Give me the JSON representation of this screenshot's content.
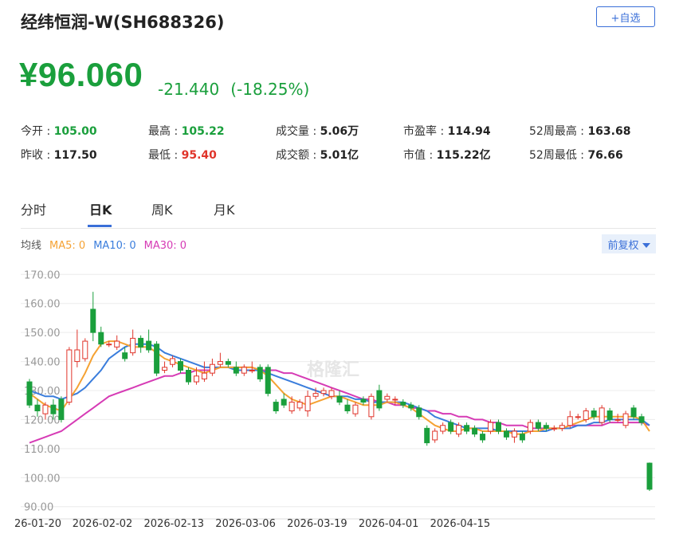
{
  "header": {
    "title": "经纬恒润-W(SH688326)",
    "watch_label": "+自选"
  },
  "quote": {
    "price": "¥96.060",
    "change": "-21.440",
    "change_pct": "(-18.25%)"
  },
  "stats": {
    "open_label": "今开 : ",
    "open": "105.00",
    "prev_close_label": "昨收 : ",
    "prev_close": "117.50",
    "high_label": "最高 : ",
    "high": "105.22",
    "low_label": "最低 : ",
    "low": "95.40",
    "volume_label": "成交量 : ",
    "volume": "5.06万",
    "turnover_label": "成交额 : ",
    "turnover": "5.01亿",
    "pe_label": "市盈率 : ",
    "pe": "114.94",
    "mktcap_label": "市值 : ",
    "mktcap": "115.22亿",
    "wk52_high_label": "52周最高 : ",
    "wk52_high": "163.68",
    "wk52_low_label": "52周最低 : ",
    "wk52_low": "76.66"
  },
  "tabs": [
    "分时",
    "日K",
    "周K",
    "月K"
  ],
  "active_tab": 1,
  "ma": {
    "label": "均线",
    "ma5": "MA5: 0",
    "ma10": "MA10: 0",
    "ma30": "MA30: 0"
  },
  "adjust_label": "前复权",
  "colors": {
    "up": "#e0352b",
    "down": "#1a9f3c",
    "ma5": "#f5a233",
    "ma10": "#3a7ddc",
    "ma30": "#d63bb5",
    "accent": "#3a6fd8"
  },
  "chart_data": {
    "type": "candlestick",
    "ylim": [
      88,
      172
    ],
    "y_ticks": [
      "170.00",
      "160.00",
      "150.00",
      "140.00",
      "130.00",
      "120.00",
      "110.00",
      "100.00",
      "90.00"
    ],
    "x_labels": [
      "26-01-20",
      "2026-02-02",
      "2026-02-13",
      "2026-03-06",
      "2026-03-19",
      "2026-04-01",
      "2026-04-15"
    ],
    "x_label_index": [
      0,
      9,
      18,
      27,
      36,
      45,
      54
    ],
    "candles": [
      [
        133,
        125,
        134,
        124
      ],
      [
        125,
        123,
        127,
        121
      ],
      [
        122,
        125,
        126,
        120
      ],
      [
        125,
        122,
        127,
        120
      ],
      [
        127,
        120,
        128,
        119
      ],
      [
        126,
        144,
        145,
        125
      ],
      [
        140,
        144,
        151,
        138
      ],
      [
        141,
        147,
        148,
        140
      ],
      [
        158,
        150,
        164,
        147
      ],
      [
        150,
        146,
        152,
        145
      ],
      [
        146,
        146,
        147,
        145
      ],
      [
        145,
        147,
        149,
        144
      ],
      [
        143,
        141,
        145,
        140
      ],
      [
        143,
        148,
        151,
        142
      ],
      [
        148,
        145,
        149,
        143
      ],
      [
        147,
        144,
        151,
        143
      ],
      [
        146,
        136,
        147,
        135
      ],
      [
        137,
        138,
        140,
        136
      ],
      [
        139,
        141,
        142,
        138
      ],
      [
        140,
        137,
        141,
        136
      ],
      [
        137,
        133,
        138,
        132
      ],
      [
        133,
        135,
        138,
        132
      ],
      [
        134,
        136,
        140,
        133
      ],
      [
        136,
        139,
        141,
        135
      ],
      [
        139,
        140,
        143,
        138
      ],
      [
        140,
        139,
        141,
        138
      ],
      [
        138,
        136,
        140,
        135
      ],
      [
        136,
        138,
        139,
        135
      ],
      [
        137,
        137,
        140,
        136
      ],
      [
        138,
        134,
        139,
        133
      ],
      [
        138,
        129,
        139,
        128
      ],
      [
        126,
        123,
        127,
        122
      ],
      [
        127,
        125,
        129,
        124
      ],
      [
        123,
        126,
        128,
        122
      ],
      [
        124,
        126,
        127,
        123
      ],
      [
        123,
        128,
        130,
        121
      ],
      [
        128,
        129,
        131,
        127
      ],
      [
        129,
        130,
        131,
        128
      ],
      [
        128,
        130,
        131,
        127
      ],
      [
        128,
        126,
        130,
        125
      ],
      [
        125,
        123,
        127,
        122
      ],
      [
        122,
        125,
        126,
        121
      ],
      [
        127,
        126,
        128,
        125
      ],
      [
        121,
        128,
        129,
        120
      ],
      [
        130,
        124,
        132,
        123
      ],
      [
        127,
        128,
        129,
        126
      ],
      [
        127,
        127,
        128,
        125
      ],
      [
        126,
        125,
        127,
        124
      ],
      [
        125,
        124,
        126,
        123
      ],
      [
        124,
        121,
        125,
        120
      ],
      [
        117,
        112,
        118,
        111
      ],
      [
        113,
        116,
        117,
        112
      ],
      [
        116,
        118,
        119,
        115
      ],
      [
        119,
        116,
        120,
        115
      ],
      [
        115,
        118,
        119,
        114
      ],
      [
        118,
        116,
        119,
        115
      ],
      [
        117,
        115,
        118,
        114
      ],
      [
        115,
        113,
        116,
        112
      ],
      [
        116,
        119,
        120,
        115
      ],
      [
        119,
        116,
        120,
        115
      ],
      [
        116,
        114,
        117,
        113
      ],
      [
        114,
        116,
        117,
        112
      ],
      [
        115,
        113,
        116,
        112
      ],
      [
        116,
        119,
        120,
        115
      ],
      [
        119,
        117,
        120,
        116
      ],
      [
        118,
        117,
        119,
        116
      ],
      [
        117,
        117,
        118,
        116
      ],
      [
        117,
        118,
        119,
        116
      ],
      [
        118,
        121,
        123,
        117
      ],
      [
        121,
        121,
        122,
        120
      ],
      [
        120,
        123,
        124,
        119
      ],
      [
        123,
        121,
        124,
        120
      ],
      [
        119,
        124,
        125,
        118
      ],
      [
        123,
        120,
        124,
        119
      ],
      [
        120,
        120,
        122,
        119
      ],
      [
        118,
        122,
        123,
        117
      ],
      [
        124,
        121,
        125,
        120
      ],
      [
        121,
        119,
        122,
        118
      ],
      [
        105,
        96,
        105.22,
        95.4
      ]
    ],
    "ma5": [
      129,
      127,
      125,
      124,
      123,
      127,
      131,
      136,
      142,
      146,
      147,
      147,
      146,
      145,
      145,
      145,
      143,
      141,
      140,
      139,
      138,
      137,
      136,
      137,
      138,
      138,
      138,
      138,
      138,
      137,
      135,
      132,
      129,
      127,
      126,
      125,
      126,
      127,
      128,
      128,
      127,
      126,
      125,
      125,
      125,
      126,
      126,
      125,
      124,
      122,
      120,
      118,
      117,
      116,
      116,
      117,
      117,
      116,
      116,
      116,
      116,
      115,
      115,
      116,
      116,
      117,
      117,
      117,
      118,
      119,
      120,
      121,
      121,
      121,
      121,
      121,
      121,
      120,
      116
    ],
    "ma10": [
      130,
      129,
      128,
      128,
      127,
      128,
      129,
      131,
      134,
      137,
      141,
      143,
      145,
      146,
      146,
      146,
      145,
      143,
      142,
      141,
      140,
      139,
      138,
      138,
      138,
      138,
      137,
      137,
      137,
      137,
      136,
      135,
      134,
      133,
      132,
      131,
      130,
      129,
      128,
      128,
      128,
      127,
      127,
      126,
      126,
      126,
      126,
      126,
      125,
      124,
      123,
      121,
      120,
      119,
      118,
      117,
      117,
      117,
      117,
      116,
      116,
      116,
      116,
      116,
      116,
      116,
      117,
      117,
      117,
      118,
      118,
      119,
      119,
      120,
      120,
      120,
      120,
      120,
      118
    ],
    "ma30": [
      112,
      113,
      114,
      115,
      116,
      118,
      120,
      122,
      124,
      126,
      128,
      129,
      130,
      131,
      132,
      133,
      134,
      135,
      135,
      136,
      136,
      137,
      137,
      137,
      138,
      138,
      138,
      138,
      138,
      137,
      137,
      137,
      136,
      136,
      135,
      134,
      133,
      132,
      131,
      130,
      129,
      128,
      127,
      127,
      126,
      126,
      125,
      125,
      124,
      124,
      123,
      123,
      122,
      122,
      121,
      121,
      120,
      120,
      119,
      119,
      118,
      118,
      118,
      117,
      117,
      117,
      117,
      117,
      118,
      118,
      118,
      118,
      118,
      119,
      119,
      119,
      119,
      119,
      118
    ]
  }
}
